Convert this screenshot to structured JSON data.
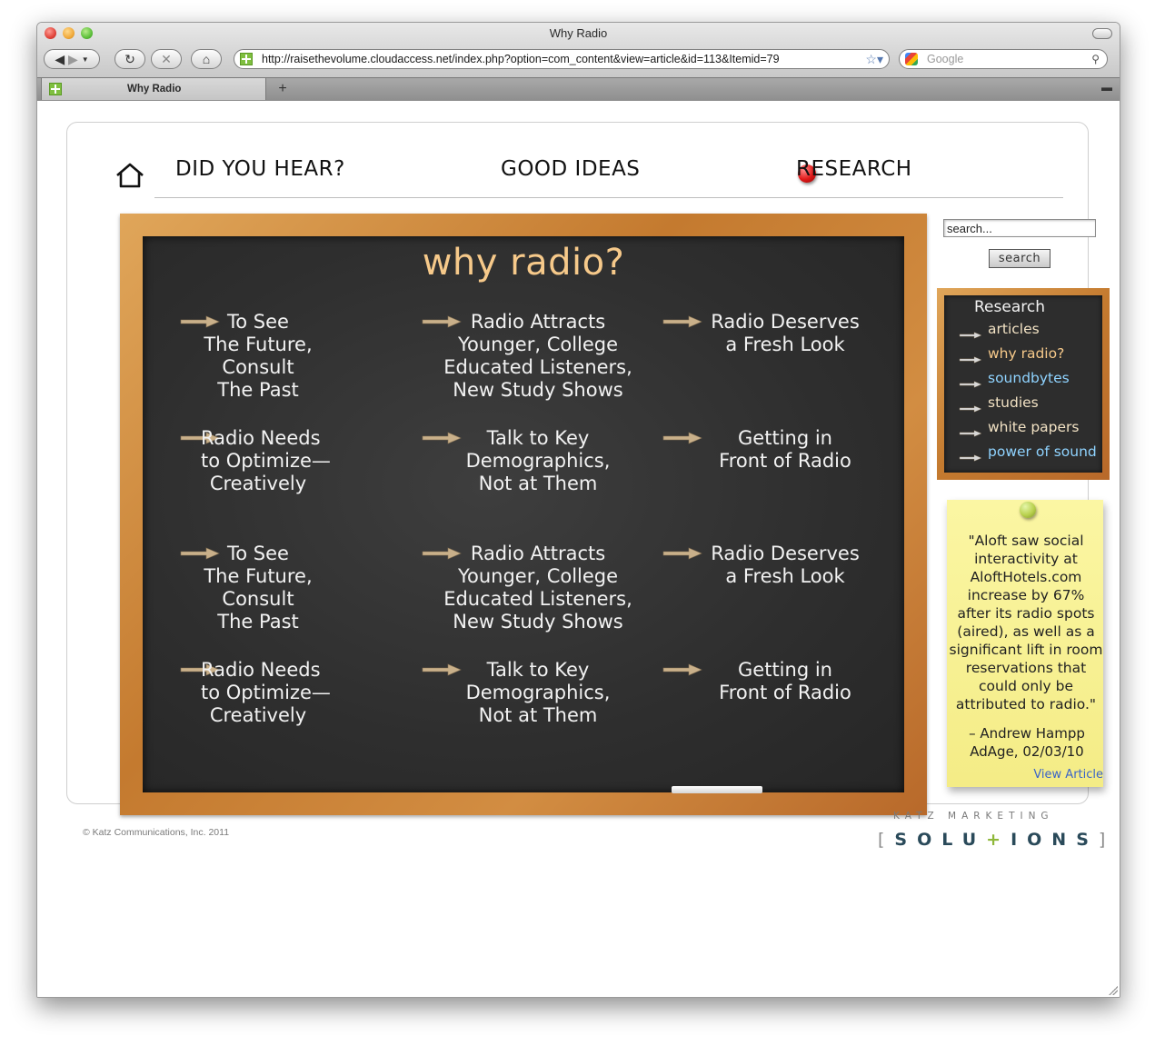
{
  "window": {
    "title": "Why Radio",
    "url": "http://raisethevolume.cloudaccess.net/index.php?option=com_content&view=article&id=113&Itemid=79",
    "search_placeholder": "Google",
    "tab_title": "Why Radio",
    "new_tab_label": "+"
  },
  "nav": {
    "items": [
      "DID YOU HEAR?",
      "GOOD IDEAS",
      "RESEARCH"
    ],
    "active": "RESEARCH"
  },
  "board": {
    "title": "why radio?",
    "items": [
      "To See\nThe Future,\nConsult\nThe Past",
      "Radio Attracts\nYounger, College\nEducated Listeners,\nNew Study Shows",
      "Radio Deserves\na Fresh Look",
      "Radio Needs\nto Optimize—\nCreatively",
      "Talk to Key\nDemographics,\nNot at Them",
      "Getting in\nFront of Radio",
      "To See\nThe Future,\nConsult\nThe Past",
      "Radio Attracts\nYounger, College\nEducated Listeners,\nNew Study Shows",
      "Radio Deserves\na Fresh Look",
      "Radio Needs\nto Optimize—\nCreatively",
      "Talk to Key\nDemographics,\nNot at Them",
      "Getting in\nFront of Radio"
    ]
  },
  "sidebar": {
    "search_value": "search...",
    "search_button": "search",
    "research_title": "Research",
    "links": [
      "articles",
      "why radio?",
      "soundbytes",
      "studies",
      "white papers",
      "power of sound"
    ]
  },
  "sticky": {
    "quote": "\"Aloft saw social interactivity at AloftHotels.com increase by 67% after its radio spots (aired), as well as a significant lift in room reservations that could only be attributed to radio.\"",
    "cite": "– Andrew Hampp\nAdAge, 02/03/10",
    "link": "View Article"
  },
  "footer": {
    "copyright": "© Katz Communications, Inc. 2011",
    "brand_top": "KATZ MARKETING",
    "brand_main": "SOLU+IONS"
  },
  "colors": {
    "board_title": "#f6c98a",
    "link_tan": "#f2e2c4",
    "link_active": "#f6c98a",
    "link_blue": "#8fd3ff",
    "sticky": "#fbf6a3",
    "pin_red": "#e01818"
  }
}
